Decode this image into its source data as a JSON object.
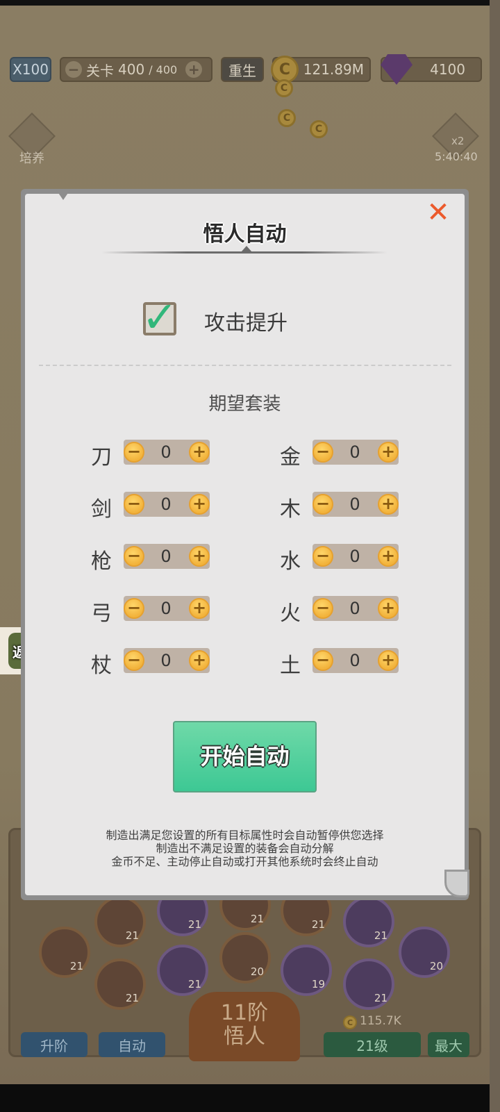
{
  "hud": {
    "multiplier": "X100",
    "level_label": "关卡",
    "level_current": "400",
    "level_total": "/ 400",
    "rebirth": "重生",
    "coins": "121.89M",
    "gems": "4100",
    "cultivate": "培养",
    "boost": "x2",
    "timer": "5:40:40"
  },
  "return_button": "返回",
  "bottom": {
    "upgrade_button": "升阶",
    "auto_button": "自动",
    "rank_line1": "11阶",
    "rank_line2": "悟人",
    "cost": "115.7K",
    "level_value": "21级",
    "max_button": "最大",
    "zodiac_levels": [
      "21",
      "21",
      "21",
      "21",
      "21",
      "21",
      "21",
      "20",
      "21",
      "20",
      "19",
      "21"
    ]
  },
  "dialog": {
    "title": "悟人自动",
    "close_icon": "close-x-icon",
    "checkbox_label": "攻击提升",
    "checkbox_checked": true,
    "section_title": "期望套装",
    "left_sets": [
      {
        "label": "刀",
        "value": "0"
      },
      {
        "label": "剑",
        "value": "0"
      },
      {
        "label": "枪",
        "value": "0"
      },
      {
        "label": "弓",
        "value": "0"
      },
      {
        "label": "杖",
        "value": "0"
      }
    ],
    "right_sets": [
      {
        "label": "金",
        "value": "0"
      },
      {
        "label": "木",
        "value": "0"
      },
      {
        "label": "水",
        "value": "0"
      },
      {
        "label": "火",
        "value": "0"
      },
      {
        "label": "土",
        "value": "0"
      }
    ],
    "minus": "−",
    "plus": "+",
    "start_button": "开始自动",
    "notes": [
      "制造出满足您设置的所有目标属性时会自动暂停供您选择",
      "制造出不满足设置的装备会自动分解",
      "金币不足、主动停止自动或打开其他系统时会终止自动"
    ]
  },
  "colors": {
    "accent_green": "#3dc894",
    "close_orange": "#ec5a2c",
    "stepper_gold": "#f2b33c"
  }
}
